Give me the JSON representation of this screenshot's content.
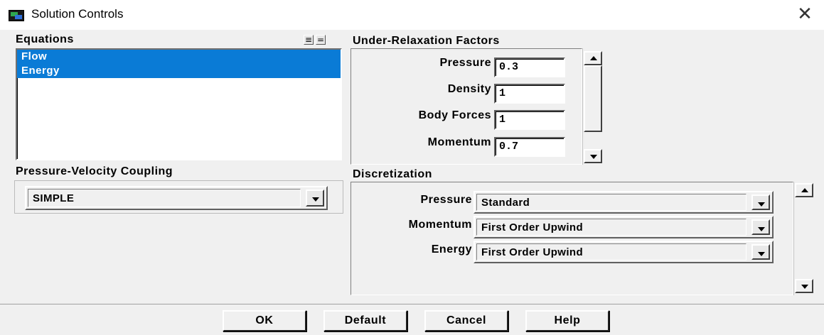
{
  "window": {
    "title": "Solution Controls",
    "icon": "fluent-app-icon",
    "close_glyph": "✕"
  },
  "equations": {
    "label": "Equations",
    "select_all_glyph": "≡",
    "deselect_all_glyph": "=",
    "items": [
      {
        "label": "Flow",
        "selected": true
      },
      {
        "label": "Energy",
        "selected": true
      }
    ]
  },
  "pressure_velocity": {
    "label": "Pressure-Velocity Coupling",
    "value": "SIMPLE"
  },
  "under_relaxation": {
    "label": "Under-Relaxation Factors",
    "fields": [
      {
        "label": "Pressure",
        "value": "0.3"
      },
      {
        "label": "Density",
        "value": "1"
      },
      {
        "label": "Body Forces",
        "value": "1"
      },
      {
        "label": "Momentum",
        "value": "0.7"
      }
    ]
  },
  "discretization": {
    "label": "Discretization",
    "rows": [
      {
        "label": "Pressure",
        "value": "Standard"
      },
      {
        "label": "Momentum",
        "value": "First Order Upwind"
      },
      {
        "label": "Energy",
        "value": "First Order Upwind"
      }
    ]
  },
  "buttons": {
    "ok": "OK",
    "default": "Default",
    "cancel": "Cancel",
    "help": "Help"
  },
  "colors": {
    "selection": "#0a7bd6",
    "dialog_bg": "#f0f0f0"
  }
}
